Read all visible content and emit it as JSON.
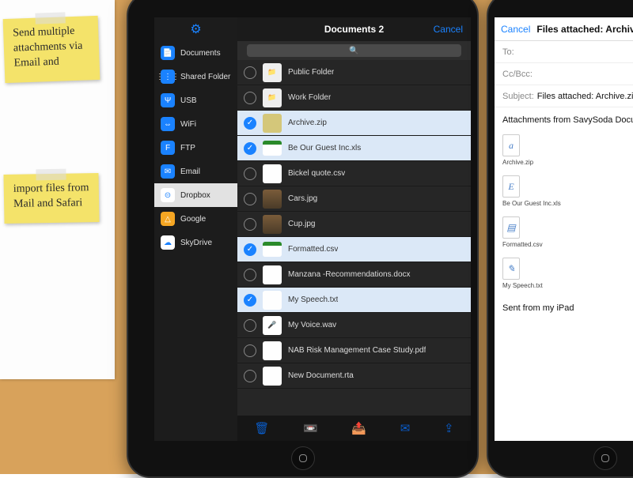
{
  "notes": {
    "note1": "Send multiple attachments via Email and",
    "note2": "import files from Mail and Safari"
  },
  "app": {
    "title": "Documents 2",
    "cancel": "Cancel",
    "sidebar": [
      {
        "icon": "📄",
        "bg": "#1a82ff",
        "label": "Documents"
      },
      {
        "icon": "⋮⋮⋮",
        "bg": "#1a82ff",
        "label": "Shared Folder"
      },
      {
        "icon": "Ψ",
        "bg": "#1a82ff",
        "label": "USB"
      },
      {
        "icon": "⇔",
        "bg": "#1a82ff",
        "label": "WiFi"
      },
      {
        "icon": "F",
        "bg": "#1a82ff",
        "label": "FTP"
      },
      {
        "icon": "✉",
        "bg": "#1a82ff",
        "label": "Email"
      },
      {
        "icon": "⊝",
        "bg": "#ffffff",
        "label": "Dropbox",
        "selected": true
      },
      {
        "icon": "△",
        "bg": "#f5a623",
        "label": "Google"
      },
      {
        "icon": "☁",
        "bg": "#ffffff",
        "label": "SkyDrive"
      }
    ],
    "files": [
      {
        "name": "Public Folder",
        "thumb": "folder",
        "selected": false
      },
      {
        "name": "Work Folder",
        "thumb": "folder",
        "selected": false
      },
      {
        "name": "Archive.zip",
        "thumb": "zip",
        "selected": true
      },
      {
        "name": "Be Our Guest Inc.xls",
        "thumb": "csv",
        "selected": true
      },
      {
        "name": "Bickel quote.csv",
        "thumb": "doc",
        "selected": false
      },
      {
        "name": "Cars.jpg",
        "thumb": "photo",
        "selected": false
      },
      {
        "name": "Cup.jpg",
        "thumb": "photo",
        "selected": false
      },
      {
        "name": "Formatted.csv",
        "thumb": "csv",
        "selected": true
      },
      {
        "name": "Manzana -Recommendations.docx",
        "thumb": "doc",
        "selected": false
      },
      {
        "name": "My Speech.txt",
        "thumb": "doc",
        "selected": true
      },
      {
        "name": "My Voice.wav",
        "thumb": "audio",
        "selected": false
      },
      {
        "name": "NAB Risk Management Case Study.pdf",
        "thumb": "doc",
        "selected": false
      },
      {
        "name": "New Document.rta",
        "thumb": "doc",
        "selected": false
      }
    ],
    "toolbar": [
      "🗑",
      "📼",
      "📤",
      "✉",
      "⇪"
    ]
  },
  "mail": {
    "cancel": "Cancel",
    "title": "Files attached:  Archive.zip Be Our Gues",
    "to_label": "To:",
    "cc_label": "Cc/Bcc:",
    "subject_label": "Subject:",
    "subject_value": "Files attached:  Archive.zip Be Our Guest Inc.",
    "body_line": "Attachments from SavySoda Documents for iOS.",
    "signature": "Sent from my iPad",
    "attachments": [
      {
        "glyph": "a",
        "name": "Archive.zip"
      },
      {
        "glyph": "E",
        "name": "Be Our Guest Inc.xls"
      },
      {
        "glyph": "▤",
        "name": "Formatted.csv"
      },
      {
        "glyph": "✎",
        "name": "My Speech.txt"
      }
    ]
  }
}
